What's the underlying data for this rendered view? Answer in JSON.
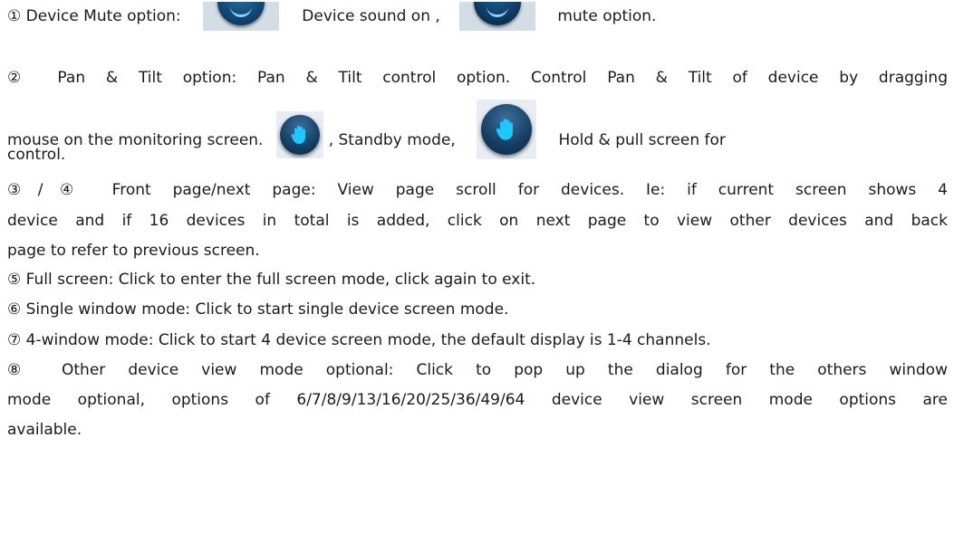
{
  "paragraphs": {
    "p1": {
      "part1": "① Device Mute option:",
      "part2": "Device sound on ,",
      "part3": "mute option."
    },
    "p2": {
      "line1": "② Pan & Tilt option: Pan & Tilt control option. Control Pan & Tilt of device by dragging",
      "line2_part1": "mouse on the monitoring screen.",
      "line2_part2": ", Standby mode,",
      "line2_part3": "Hold & pull screen for",
      "line3": "control."
    },
    "p3": {
      "line1": "③/④ Front page/next page: View page scroll for devices. Ie: if current screen shows 4",
      "line2": "device and if 16 devices in total is added, click on next page to view other devices and back",
      "line3": "page to refer to previous screen."
    },
    "p5": "⑤ Full screen: Click to enter the full screen mode, click again to exit.",
    "p6": "⑥ Single window mode: Click to start single device screen mode.",
    "p7": "⑦ 4-window mode: Click to start 4 device screen mode, the default display is 1-4 channels.",
    "p8": {
      "line1": "⑧ Other device view mode optional: Click to pop up the dialog for the others window",
      "line2": "mode optional, options of 6/7/8/9/13/16/20/25/36/49/64 device view screen mode options are",
      "line3": "available."
    }
  },
  "icons": {
    "sound_on": "speaker-sound-on-icon",
    "mute": "speaker-mute-icon",
    "standby": "hand-standby-icon",
    "control": "hand-control-icon"
  },
  "colors": {
    "hand_glyph": "#1ec8ff",
    "button_dark": "#0f3f6a"
  }
}
